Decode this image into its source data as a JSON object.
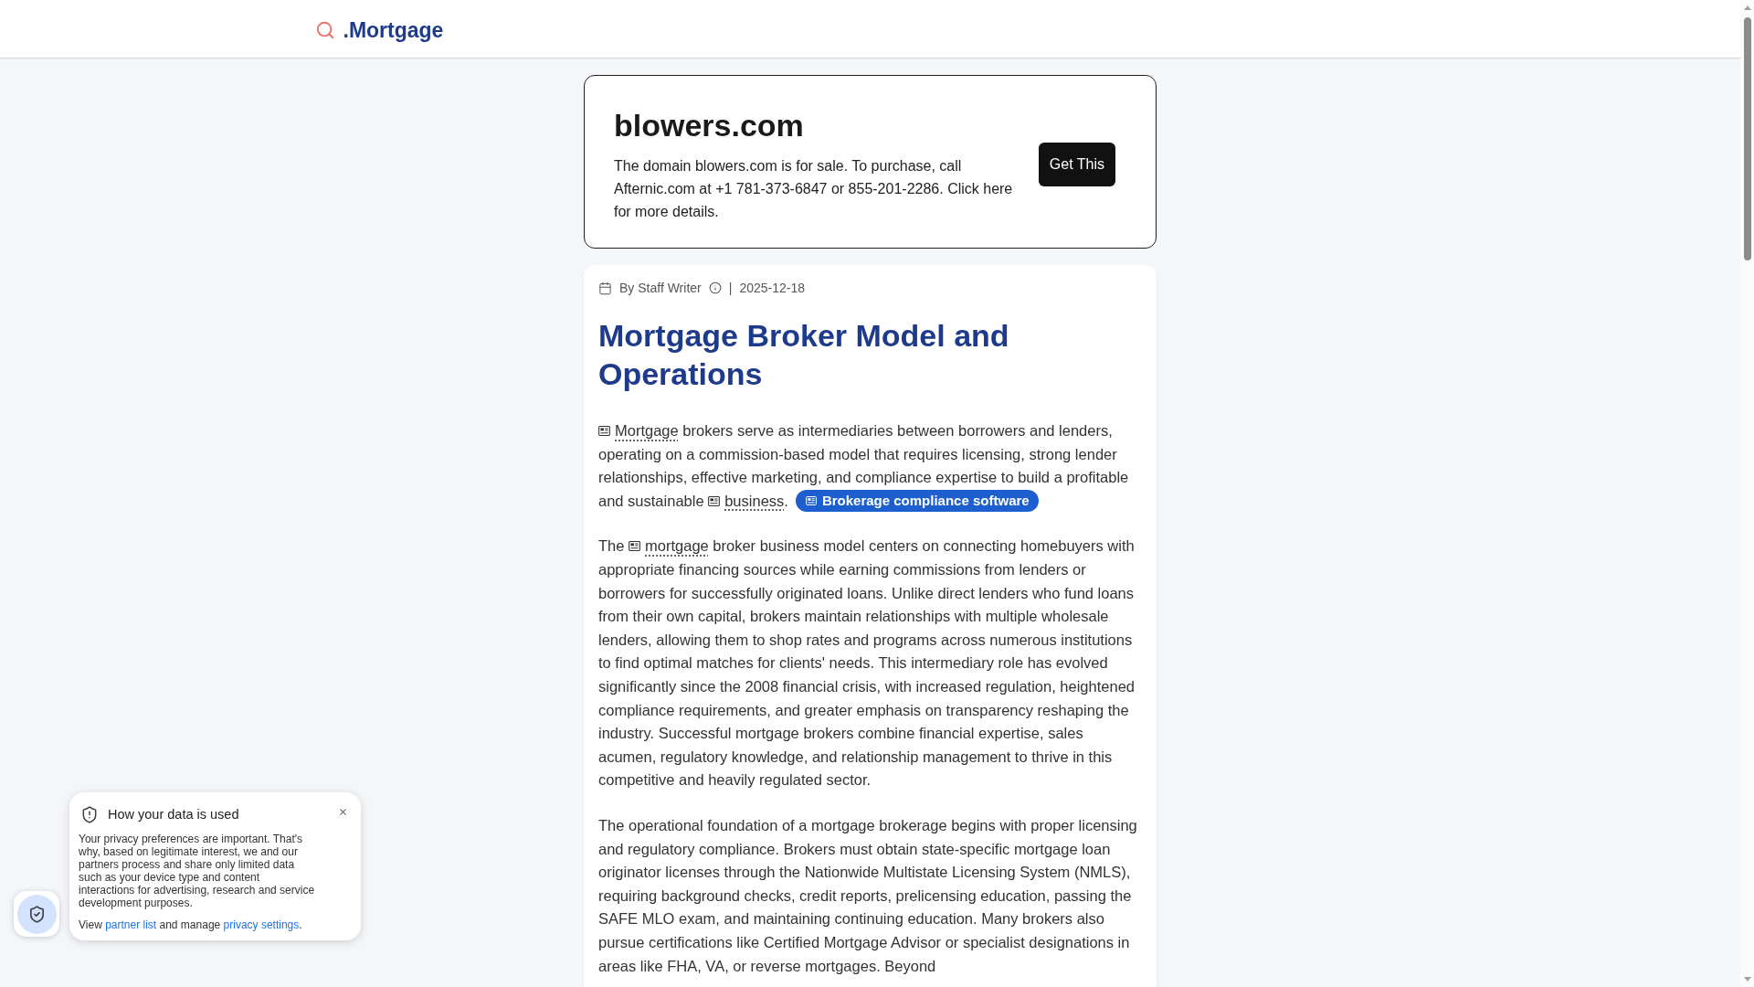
{
  "header": {
    "logo_text": ".Mortgage"
  },
  "domain_banner": {
    "title": "blowers.com",
    "text": "The domain blowers.com is for sale. To purchase, call Afternic.com at +1 781-373-6847 or 855-201-2286. Click here for more details.",
    "button": "Get This"
  },
  "article": {
    "meta": {
      "author": "By Staff Writer",
      "separator": "|",
      "date": "2025-12-18"
    },
    "title": "Mortgage Broker Model and Operations",
    "paragraphs": [
      {
        "segments": [
          {
            "kind": "term",
            "text": "Mortgage"
          },
          {
            "kind": "text",
            "text": " brokers serve as intermediaries between borrowers and lenders, operating on a commission-based model that requires licensing, strong lender relationships, effective marketing, and compliance expertise to build a profitable and sustainable "
          },
          {
            "kind": "term",
            "text": "business"
          },
          {
            "kind": "text",
            "text": "."
          },
          {
            "kind": "badge",
            "text": "Brokerage compliance software"
          }
        ]
      },
      {
        "segments": [
          {
            "kind": "text",
            "text": "The "
          },
          {
            "kind": "term",
            "text": "mortgage"
          },
          {
            "kind": "text",
            "text": " broker business model centers on connecting homebuyers with appropriate financing sources while earning commissions from lenders or borrowers for successfully originated loans. Unlike direct lenders who fund loans from their own capital, brokers maintain relationships with multiple wholesale lenders, allowing them to shop rates and programs across numerous institutions to find optimal matches for clients' needs. This intermediary role has evolved significantly since the 2008 financial crisis, with increased regulation, heightened compliance requirements, and greater emphasis on transparency reshaping the industry. Successful mortgage brokers combine financial expertise, sales acumen, regulatory knowledge, and relationship management to thrive in this competitive and heavily regulated sector."
          }
        ]
      },
      {
        "segments": [
          {
            "kind": "text",
            "text": "The operational foundation of a mortgage brokerage begins with proper licensing and regulatory compliance. Brokers must obtain state-specific mortgage loan originator licenses through the Nationwide Multistate Licensing System (NMLS), requiring background checks, credit reports, prelicensing education, passing the SAFE MLO exam, and maintaining continuing education. Many brokers also pursue certifications like Certified Mortgage Advisor or specialist designations in areas like FHA, VA, or reverse mortgages. Beyond"
          }
        ]
      }
    ]
  },
  "privacy_notice": {
    "title": "How your data is used",
    "body": "Your privacy preferences are important. That's why, based on legitimate interest, we and our partners process and share only limited data such as your device type and content interactions for advertising, research and service development purposes.",
    "footer": [
      {
        "kind": "text",
        "text": "View "
      },
      {
        "kind": "link",
        "text": "partner list"
      },
      {
        "kind": "text",
        "text": " and manage "
      },
      {
        "kind": "link",
        "text": "privacy settings"
      },
      {
        "kind": "text",
        "text": "."
      }
    ]
  }
}
